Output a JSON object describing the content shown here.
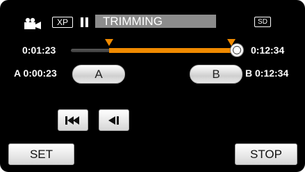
{
  "status_bar": {
    "mode_icon": "video-camera-icon",
    "quality": "XP",
    "playback_icon": "pause-icon",
    "title": "TRIMMING",
    "media": "SD"
  },
  "timeline": {
    "current_time": "0:01:23",
    "end_time": "0:12:34",
    "fill_color": "#f08a00"
  },
  "points": {
    "a_label": "A",
    "a_time": "A 0:00:23",
    "a_button": "A",
    "b_label": "B",
    "b_time": "B 0:12:34",
    "b_button": "B"
  },
  "nav": {
    "skip_start_icon": "skip-to-start-icon",
    "frame_back_icon": "frame-back-icon"
  },
  "buttons": {
    "set": "SET",
    "stop": "STOP"
  }
}
